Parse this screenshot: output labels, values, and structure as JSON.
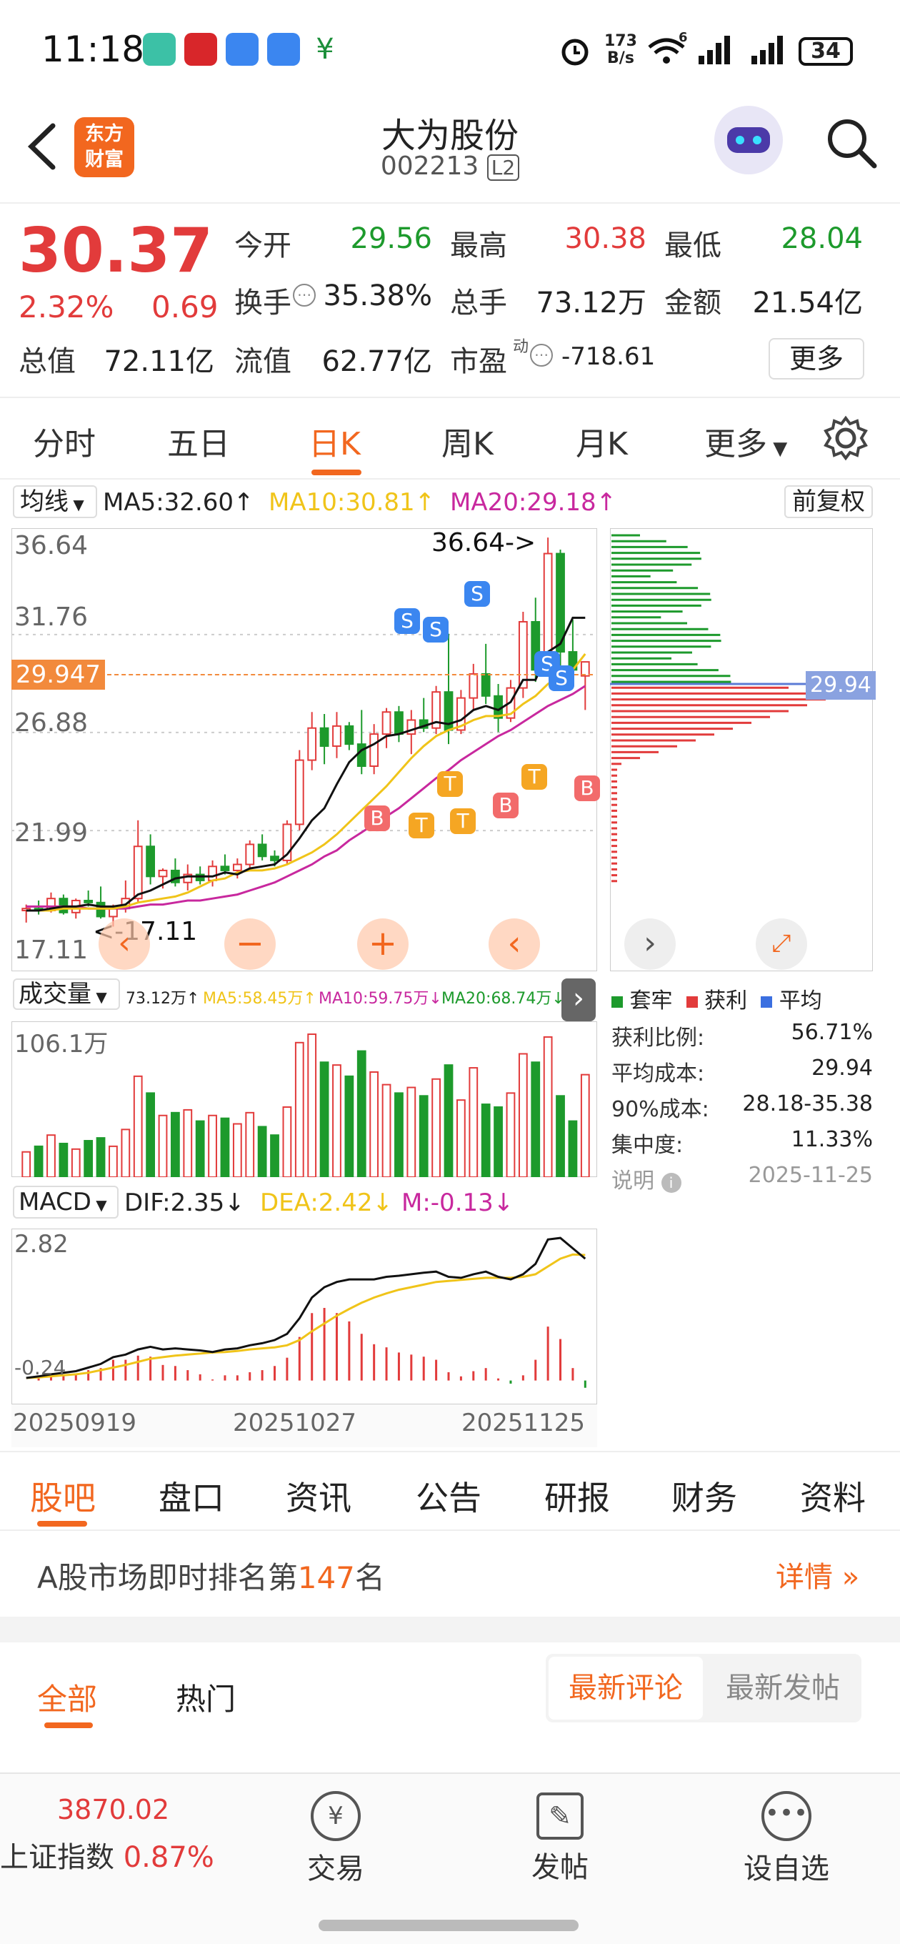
{
  "status_bar": {
    "time": "11:18",
    "net_speed_top": "173",
    "net_speed_bottom": "B/s",
    "wifi_tag": "6",
    "battery": "34"
  },
  "header": {
    "logo_line1": "东方",
    "logo_line2": "财富",
    "stock_name": "大为股份",
    "stock_code": "002213",
    "level_badge": "L2"
  },
  "quote": {
    "price": "30.37",
    "change_pct": "2.32%",
    "change_abs": "0.69",
    "open_label": "今开",
    "open": "29.56",
    "high_label": "最高",
    "high": "30.38",
    "low_label": "最低",
    "low": "28.04",
    "turnover_label": "换手",
    "turnover": "35.38%",
    "volume_label": "总手",
    "volume": "73.12万",
    "amount_label": "金额",
    "amount": "21.54亿",
    "mcap_label": "总值",
    "mcap": "72.11亿",
    "float_label": "流值",
    "float_cap": "62.77亿",
    "pe_label": "市盈",
    "pe_sup": "动",
    "pe": "-718.61",
    "more_button": "更多"
  },
  "kline_tabs": [
    {
      "label": "分时",
      "active": false
    },
    {
      "label": "五日",
      "active": false
    },
    {
      "label": "日K",
      "active": true
    },
    {
      "label": "周K",
      "active": false
    },
    {
      "label": "月K",
      "active": false
    },
    {
      "label": "更多",
      "active": false
    }
  ],
  "ma_bar": {
    "selector": "均线",
    "ma5": "MA5:32.60",
    "ma10": "MA10:30.81",
    "ma20": "MA20:29.18",
    "adjust_button": "前复权"
  },
  "price_panel": {
    "axis_labels": [
      "36.64",
      "31.76",
      "26.88",
      "21.99",
      "17.11"
    ],
    "current_price_tag": "29.947",
    "max_annotation": "36.64->",
    "min_annotation": "<-17.11",
    "signals_s": "S",
    "signals_t": "T",
    "signals_b": "B"
  },
  "chip_panel": {
    "price_tag": "29.94",
    "legend": [
      "套牢",
      "获利",
      "平均"
    ],
    "stats": [
      {
        "label": "获利比例:",
        "value": "56.71%"
      },
      {
        "label": "平均成本:",
        "value": "29.94"
      },
      {
        "label": "90%成本:",
        "value": "28.18-35.38"
      },
      {
        "label": "集中度:",
        "value": "11.33%"
      }
    ],
    "note_label": "说明",
    "date": "2025-11-25"
  },
  "volume_bar": {
    "selector": "成交量",
    "vol": "73.12万",
    "ma5": "MA5:58.45万",
    "ma10": "MA10:59.75万",
    "ma20": "MA20:68.74万",
    "axis_max": "106.1万"
  },
  "macd_bar": {
    "selector": "MACD",
    "dif": "DIF:2.35",
    "dea": "DEA:2.42",
    "m": "M:-0.13",
    "axis_max": "2.82",
    "axis_min": "-0.24"
  },
  "x_dates": [
    "20250919",
    "20251027",
    "20251125"
  ],
  "chart_data": {
    "type": "candlestick",
    "ylim": [
      17.11,
      36.64
    ],
    "candles": [
      [
        18.0,
        18.3,
        17.4,
        18.1
      ],
      [
        18.1,
        18.5,
        17.8,
        18.0
      ],
      [
        18.0,
        18.9,
        17.9,
        18.6
      ],
      [
        18.6,
        18.8,
        17.8,
        17.9
      ],
      [
        17.9,
        18.6,
        17.6,
        18.5
      ],
      [
        18.5,
        19.0,
        18.2,
        18.4
      ],
      [
        18.4,
        19.2,
        17.6,
        17.7
      ],
      [
        17.7,
        18.3,
        17.2,
        18.1
      ],
      [
        18.1,
        19.5,
        17.9,
        18.6
      ],
      [
        18.6,
        22.5,
        18.4,
        21.2
      ],
      [
        21.2,
        21.8,
        19.3,
        19.7
      ],
      [
        19.7,
        20.1,
        19.1,
        20.0
      ],
      [
        20.0,
        20.6,
        19.2,
        19.4
      ],
      [
        19.4,
        20.3,
        19.0,
        19.8
      ],
      [
        19.8,
        20.2,
        19.3,
        19.5
      ],
      [
        19.5,
        20.5,
        19.2,
        20.2
      ],
      [
        20.2,
        20.8,
        19.8,
        20.0
      ],
      [
        20.0,
        20.6,
        19.6,
        20.3
      ],
      [
        20.3,
        21.5,
        20.0,
        21.3
      ],
      [
        21.3,
        21.8,
        20.5,
        20.7
      ],
      [
        20.7,
        21.0,
        20.2,
        20.5
      ],
      [
        20.5,
        22.5,
        20.3,
        22.3
      ],
      [
        22.3,
        26.0,
        22.0,
        25.5
      ],
      [
        25.5,
        27.9,
        25.0,
        27.1
      ],
      [
        27.1,
        27.8,
        25.3,
        26.2
      ],
      [
        26.2,
        27.9,
        25.6,
        27.2
      ],
      [
        27.2,
        27.4,
        26.0,
        26.3
      ],
      [
        26.3,
        28.0,
        24.8,
        25.2
      ],
      [
        25.2,
        27.3,
        24.8,
        26.8
      ],
      [
        26.8,
        28.1,
        26.1,
        27.9
      ],
      [
        27.9,
        28.2,
        26.4,
        26.8
      ],
      [
        26.8,
        28.0,
        25.8,
        27.5
      ],
      [
        27.5,
        28.6,
        26.9,
        27.1
      ],
      [
        27.1,
        29.2,
        26.8,
        28.9
      ],
      [
        28.9,
        31.8,
        26.3,
        27.0
      ],
      [
        27.0,
        29.0,
        26.8,
        28.6
      ],
      [
        28.6,
        30.3,
        28.0,
        29.8
      ],
      [
        29.8,
        31.3,
        28.3,
        28.7
      ],
      [
        28.7,
        29.3,
        26.9,
        27.6
      ],
      [
        27.6,
        29.5,
        27.4,
        29.1
      ],
      [
        29.1,
        32.9,
        28.6,
        32.4
      ],
      [
        32.4,
        33.6,
        29.4,
        30.0
      ],
      [
        30.0,
        36.6,
        29.8,
        35.8
      ],
      [
        35.8,
        36.0,
        30.2,
        30.9
      ],
      [
        30.9,
        32.5,
        29.2,
        30.0
      ],
      [
        29.7,
        30.4,
        28.0,
        30.4
      ]
    ],
    "ma5": [
      18.0,
      18.0,
      18.1,
      18.2,
      18.2,
      18.3,
      18.2,
      18.2,
      18.3,
      18.8,
      19.0,
      19.3,
      19.6,
      19.7,
      19.7,
      19.7,
      19.9,
      19.8,
      20.1,
      20.2,
      20.3,
      20.8,
      21.6,
      22.5,
      23.1,
      24.3,
      25.4,
      26.0,
      26.3,
      26.7,
      26.8,
      27.0,
      27.2,
      27.4,
      27.3,
      27.5,
      28.0,
      28.2,
      28.0,
      28.4,
      29.5,
      29.5,
      30.9,
      31.3,
      32.6,
      32.6
    ],
    "ma10": [
      18.0,
      18.0,
      18.0,
      18.1,
      18.1,
      18.1,
      18.1,
      18.1,
      18.2,
      18.4,
      18.5,
      18.6,
      18.7,
      18.9,
      19.2,
      19.5,
      19.6,
      19.9,
      20.0,
      20.0,
      20.1,
      20.3,
      20.6,
      20.9,
      21.3,
      21.8,
      22.4,
      23.0,
      23.6,
      24.2,
      24.9,
      25.6,
      26.2,
      26.7,
      27.0,
      27.2,
      27.5,
      27.7,
      27.7,
      27.8,
      28.3,
      28.7,
      29.3,
      29.7,
      30.0,
      30.8
    ],
    "ma20": [
      18.2,
      18.2,
      18.2,
      18.2,
      18.2,
      18.1,
      18.1,
      18.1,
      18.1,
      18.2,
      18.3,
      18.3,
      18.4,
      18.5,
      18.5,
      18.6,
      18.7,
      18.8,
      19.0,
      19.2,
      19.4,
      19.7,
      20.0,
      20.3,
      20.7,
      21.0,
      21.5,
      21.9,
      22.3,
      22.7,
      23.1,
      23.6,
      24.1,
      24.6,
      25.0,
      25.5,
      25.9,
      26.3,
      26.7,
      27.0,
      27.4,
      27.8,
      28.2,
      28.5,
      28.8,
      29.2
    ],
    "volume_ylim": [
      0,
      106.1
    ],
    "volume": [
      18,
      22,
      30,
      24,
      20,
      26,
      28,
      22,
      34,
      72,
      60,
      44,
      46,
      48,
      40,
      44,
      42,
      38,
      46,
      36,
      30,
      50,
      96,
      102,
      82,
      80,
      72,
      90,
      75,
      66,
      60,
      64,
      58,
      70,
      80,
      55,
      78,
      52,
      50,
      60,
      88,
      82,
      100,
      58,
      40,
      73.12
    ],
    "dif": [
      0.05,
      0.08,
      0.12,
      0.15,
      0.18,
      0.25,
      0.32,
      0.45,
      0.5,
      0.6,
      0.65,
      0.6,
      0.62,
      0.6,
      0.58,
      0.55,
      0.6,
      0.62,
      0.68,
      0.72,
      0.78,
      0.9,
      1.2,
      1.6,
      1.8,
      1.9,
      1.95,
      1.95,
      1.95,
      2.0,
      2.02,
      2.05,
      2.08,
      2.1,
      2.0,
      1.98,
      2.05,
      2.1,
      2.0,
      1.95,
      2.05,
      2.25,
      2.72,
      2.75,
      2.55,
      2.35
    ],
    "dea": [
      0.05,
      0.06,
      0.08,
      0.1,
      0.12,
      0.15,
      0.2,
      0.25,
      0.3,
      0.36,
      0.42,
      0.45,
      0.48,
      0.5,
      0.52,
      0.54,
      0.55,
      0.57,
      0.6,
      0.62,
      0.64,
      0.68,
      0.78,
      0.95,
      1.1,
      1.25,
      1.38,
      1.5,
      1.6,
      1.68,
      1.75,
      1.8,
      1.85,
      1.9,
      1.92,
      1.94,
      1.96,
      1.98,
      1.98,
      1.98,
      2.0,
      2.05,
      2.2,
      2.35,
      2.43,
      2.42
    ]
  }
}
